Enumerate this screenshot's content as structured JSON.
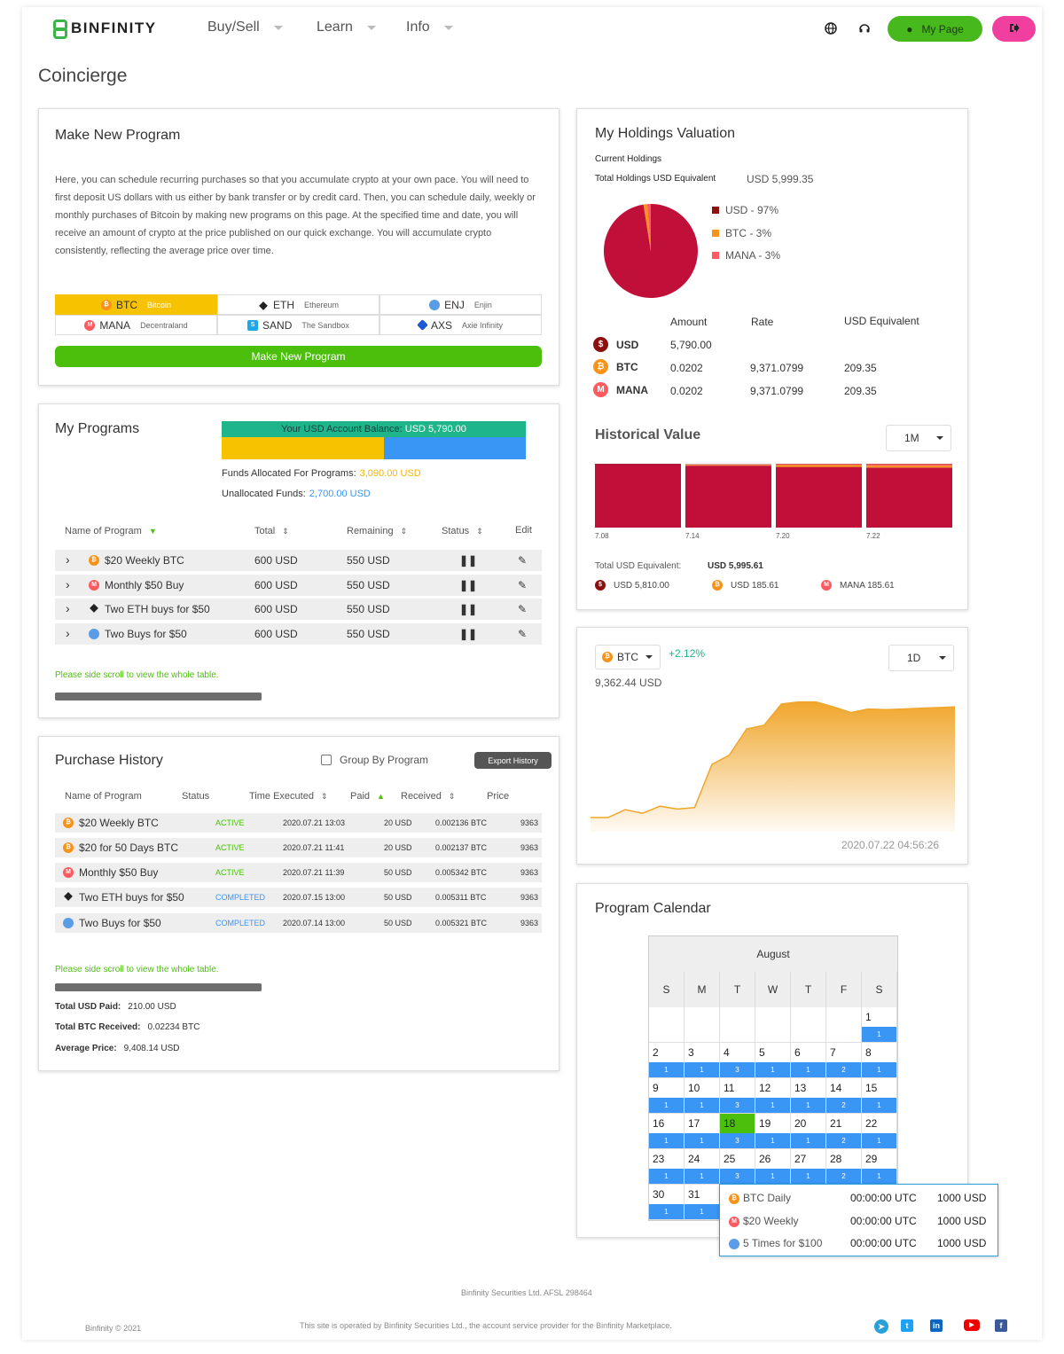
{
  "header": {
    "logo_text": "BINFINITY",
    "nav": [
      {
        "label": "Buy/Sell"
      },
      {
        "label": "Learn"
      },
      {
        "label": "Info"
      }
    ],
    "my_page_label": "My Page"
  },
  "page_title": "Coincierge",
  "make_program": {
    "title": "Make New Program",
    "description": "Here, you can schedule recurring purchases so that you accumulate crypto at your own pace. You will need to first deposit US dollars with us either by bank transfer or by credit card. Then, you can schedule daily, weekly or monthly purchases of Bitcoin by making new programs on this page. At the specified time and date, you will receive an amount of crypto at the price published on our quick exchange. You will accumulate crypto consistently, reflecting the average price over time.",
    "coins": [
      {
        "symbol": "BTC",
        "name": "Bitcoin",
        "icon": "btc-icon"
      },
      {
        "symbol": "ETH",
        "name": "Ethereum",
        "icon": "eth-icon"
      },
      {
        "symbol": "ENJ",
        "name": "Enjin",
        "icon": "enj-icon"
      },
      {
        "symbol": "MANA",
        "name": "Decentraland",
        "icon": "mana-icon"
      },
      {
        "symbol": "SAND",
        "name": "The Sandbox",
        "icon": "sand-icon"
      },
      {
        "symbol": "AXS",
        "name": "Axie Infinity",
        "icon": "axs-icon"
      }
    ],
    "button_label": "Make New Program"
  },
  "my_programs": {
    "title": "My Programs",
    "balance_label": "Your USD Account Balance:",
    "balance_value": "USD 5,790.00",
    "allocated_label": "Funds Allocated For Programs:",
    "allocated_value": "3,090.00 USD",
    "unallocated_label": "Unallocated Funds:",
    "unallocated_value": "2,700.00 USD",
    "allocated_fraction": 0.534,
    "columns": [
      "Name of Program",
      "Total",
      "Remaining",
      "Status",
      "Edit"
    ],
    "rows": [
      {
        "name": "$20 Weekly BTC",
        "coin": "btc",
        "total": "600 USD",
        "remaining": "550 USD"
      },
      {
        "name": "Monthly $50 Buy",
        "coin": "mana",
        "total": "600 USD",
        "remaining": "550 USD"
      },
      {
        "name": "Two ETH buys for $50",
        "coin": "eth",
        "total": "600 USD",
        "remaining": "550 USD"
      },
      {
        "name": "Two Buys for $50",
        "coin": "enj",
        "total": "600 USD",
        "remaining": "550 USD"
      }
    ],
    "scroll_note": "Please side scroll to view the whole table."
  },
  "purchase_history": {
    "title": "Purchase History",
    "group_label": "Group By Program",
    "export_label": "Export History",
    "columns": [
      "Name of Program",
      "Status",
      "Time Executed",
      "Paid",
      "Received",
      "Price"
    ],
    "rows": [
      {
        "name": "$20 Weekly BTC",
        "coin": "btc",
        "status": "ACTIVE",
        "time": "2020.07.21 13:03",
        "paid": "20 USD",
        "received": "0.002136 BTC",
        "price": "9363"
      },
      {
        "name": "$20 for 50 Days BTC",
        "coin": "btc",
        "status": "ACTIVE",
        "time": "2020.07.21 11:41",
        "paid": "20 USD",
        "received": "0.002137 BTC",
        "price": "9363"
      },
      {
        "name": "Monthly $50 Buy",
        "coin": "mana",
        "status": "ACTIVE",
        "time": "2020.07.21 11:39",
        "paid": "50 USD",
        "received": "0.005342 BTC",
        "price": "9363"
      },
      {
        "name": "Two ETH buys for $50",
        "coin": "eth",
        "status": "COMPLETED",
        "time": "2020.07.15 13:00",
        "paid": "50 USD",
        "received": "0.005311 BTC",
        "price": "9363"
      },
      {
        "name": "Two Buys for $50",
        "coin": "enj",
        "status": "COMPLETED",
        "time": "2020.07.14 13:00",
        "paid": "50 USD",
        "received": "0.005321 BTC",
        "price": "9363"
      }
    ],
    "scroll_note": "Please side scroll to view the whole table.",
    "totals": [
      {
        "label": "Total USD Paid:",
        "value": "210.00 USD"
      },
      {
        "label": "Total BTC Received:",
        "value": "0.02234 BTC"
      },
      {
        "label": "Average Price:",
        "value": "9,408.14 USD"
      }
    ]
  },
  "holdings": {
    "title": "My Holdings Valuation",
    "current_label": "Current Holdings",
    "total_label": "Total Holdings USD Equivalent",
    "total_value": "USD 5,999.35",
    "legend": [
      {
        "label": "USD - 97%",
        "color": "#8b1010"
      },
      {
        "label": "BTC - 3%",
        "color": "#f7931a"
      },
      {
        "label": "MANA - 3%",
        "color": "#ff5a5f"
      }
    ],
    "table_headers": [
      "Amount",
      "Rate",
      "USD Equivalent"
    ],
    "rows": [
      {
        "asset": "USD",
        "coin": "usd",
        "amount": "5,790.00",
        "rate": "",
        "usd": ""
      },
      {
        "asset": "BTC",
        "coin": "btc",
        "amount": "0.0202",
        "rate": "9,371.0799",
        "usd": "209.35"
      },
      {
        "asset": "MANA",
        "coin": "mana",
        "amount": "0.0202",
        "rate": "9,371.0799",
        "usd": "209.35"
      }
    ],
    "historical_title": "Historical Value",
    "period": "1M",
    "total_equiv_label": "Total USD Equivalent:",
    "total_equiv_value": "USD 5,995.61",
    "breakdown": [
      {
        "coin": "usd",
        "label": "USD 5,810.00"
      },
      {
        "coin": "btc",
        "label": "USD 185.61"
      },
      {
        "coin": "mana",
        "label": "MANA 185.61"
      }
    ]
  },
  "price_chart": {
    "coin": "BTC",
    "change": "+2.12%",
    "price": "9,362.44 USD",
    "period": "1D",
    "timestamp": "2020.07.22 04:56:26"
  },
  "chart_data": [
    {
      "type": "bar",
      "stacked": true,
      "categories": [
        "7.08",
        "7.14",
        "7.20",
        "7.22"
      ],
      "series": [
        {
          "name": "USD",
          "values": [
            100,
            97,
            95,
            94
          ],
          "color": "#c0103a"
        },
        {
          "name": "BTC",
          "values": [
            0,
            1,
            3,
            3
          ],
          "color": "#f7931a"
        },
        {
          "name": "MANA",
          "values": [
            0,
            1,
            2,
            3
          ],
          "color": "#ff5a5f"
        }
      ],
      "ylim": [
        0,
        100
      ]
    },
    {
      "type": "area",
      "x": [
        0,
        1,
        2,
        3,
        4,
        5,
        6,
        7,
        8,
        9,
        10,
        11,
        12,
        13,
        14,
        15,
        16,
        17,
        18,
        19,
        20,
        21
      ],
      "values": [
        9270,
        9270,
        9281,
        9276,
        9286,
        9282,
        9284,
        9345,
        9358,
        9395,
        9400,
        9430,
        9433,
        9433,
        9426,
        9418,
        9423,
        9422,
        9423,
        9424,
        9425,
        9426
      ],
      "ylim": [
        9250,
        9450
      ],
      "color": "#f0a62c"
    }
  ],
  "calendar": {
    "title": "Program Calendar",
    "month": "August",
    "dow": [
      "S",
      "M",
      "T",
      "W",
      "T",
      "F",
      "S"
    ],
    "days": [
      {
        "d": "",
        "c": ""
      },
      {
        "d": "",
        "c": ""
      },
      {
        "d": "",
        "c": ""
      },
      {
        "d": "",
        "c": ""
      },
      {
        "d": "",
        "c": ""
      },
      {
        "d": "",
        "c": ""
      },
      {
        "d": "1",
        "c": "1"
      },
      {
        "d": "2",
        "c": "1"
      },
      {
        "d": "3",
        "c": "1"
      },
      {
        "d": "4",
        "c": "3"
      },
      {
        "d": "5",
        "c": "1"
      },
      {
        "d": "6",
        "c": "1"
      },
      {
        "d": "7",
        "c": "2"
      },
      {
        "d": "8",
        "c": "1"
      },
      {
        "d": "9",
        "c": "1"
      },
      {
        "d": "10",
        "c": "1"
      },
      {
        "d": "11",
        "c": "3"
      },
      {
        "d": "12",
        "c": "1"
      },
      {
        "d": "13",
        "c": "1"
      },
      {
        "d": "14",
        "c": "2"
      },
      {
        "d": "15",
        "c": "1"
      },
      {
        "d": "16",
        "c": "1"
      },
      {
        "d": "17",
        "c": "1"
      },
      {
        "d": "18",
        "c": "3"
      },
      {
        "d": "19",
        "c": "1"
      },
      {
        "d": "20",
        "c": "1"
      },
      {
        "d": "21",
        "c": "2"
      },
      {
        "d": "22",
        "c": "1"
      },
      {
        "d": "23",
        "c": "1"
      },
      {
        "d": "24",
        "c": "1"
      },
      {
        "d": "25",
        "c": "3"
      },
      {
        "d": "26",
        "c": "1"
      },
      {
        "d": "27",
        "c": "1"
      },
      {
        "d": "28",
        "c": "2"
      },
      {
        "d": "29",
        "c": "1"
      },
      {
        "d": "30",
        "c": "1"
      },
      {
        "d": "31",
        "c": "1"
      }
    ],
    "today": "18",
    "tooltip": [
      {
        "coin": "btc",
        "name": "BTC Daily",
        "time": "00:00:00 UTC",
        "amount": "1000 USD"
      },
      {
        "coin": "mana",
        "name": "$20 Weekly",
        "time": "00:00:00 UTC",
        "amount": "1000 USD"
      },
      {
        "coin": "enj",
        "name": "5 Times for $100",
        "time": "00:00:00 UTC",
        "amount": "1000 USD"
      }
    ]
  },
  "footer": {
    "company": "Binfinity Securities Ltd. AFSL 298464",
    "copyright": "Binfinity © 2021",
    "operated": "This site is operated by Binfinity Securities Ltd., the account service provider for the Binfinity Marketplace."
  }
}
